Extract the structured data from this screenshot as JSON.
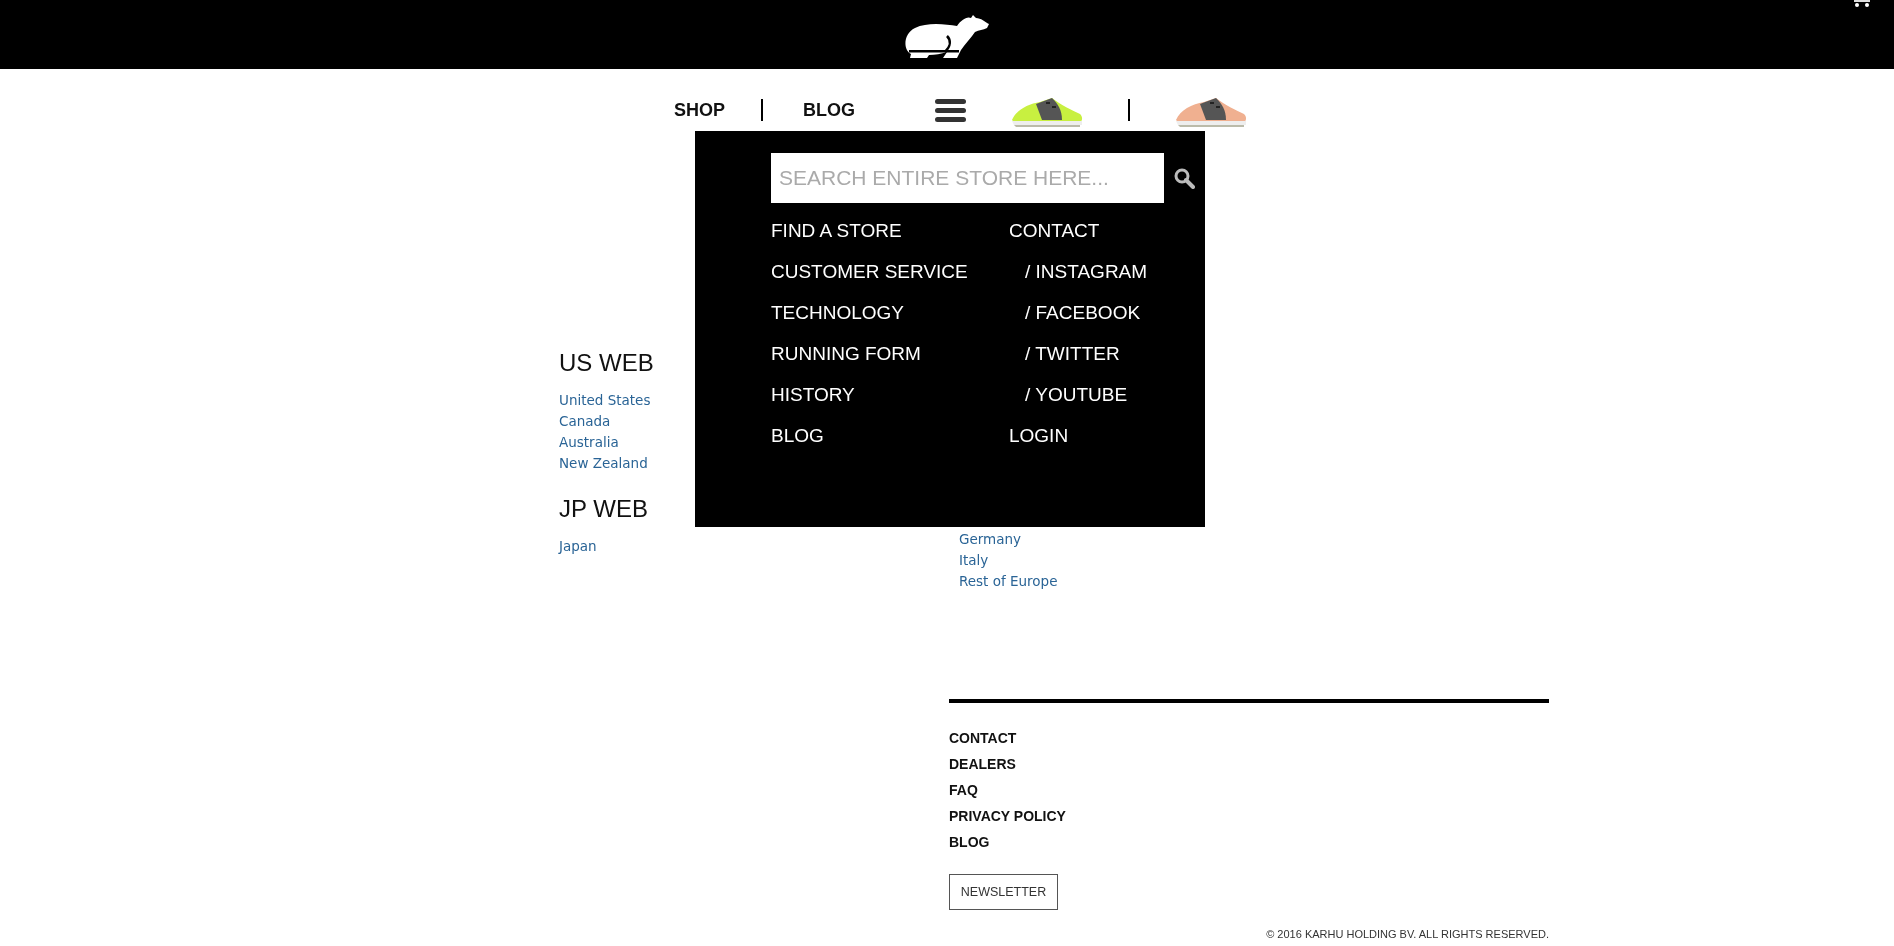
{
  "nav": {
    "items": [
      {
        "label": "SHOP"
      },
      {
        "label": "BLOG"
      }
    ]
  },
  "menu": {
    "search": {
      "placeholder": "SEARCH ENTIRE STORE HERE..."
    },
    "left": [
      {
        "label": "FIND A STORE"
      },
      {
        "label": "CUSTOMER SERVICE"
      },
      {
        "label": "TECHNOLOGY"
      },
      {
        "label": "RUNNING FORM"
      },
      {
        "label": "HISTORY"
      },
      {
        "label": "BLOG"
      }
    ],
    "right": [
      {
        "label": "CONTACT",
        "kind": "main"
      },
      {
        "label": "/ INSTAGRAM",
        "kind": "social"
      },
      {
        "label": "/ FACEBOOK",
        "kind": "social"
      },
      {
        "label": "/ TWITTER",
        "kind": "social"
      },
      {
        "label": "/ YOUTUBE",
        "kind": "social"
      },
      {
        "label": "LOGIN",
        "kind": "main"
      }
    ]
  },
  "regions": [
    {
      "title": "US WEB",
      "links": [
        "United States",
        "Canada",
        "Australia",
        "New Zealand"
      ]
    },
    {
      "title": "JP WEB",
      "links": [
        "Japan"
      ]
    }
  ],
  "eu_links": [
    "Germany",
    "Italy",
    "Rest of Europe"
  ],
  "footer": {
    "links": [
      "CONTACT",
      "DEALERS",
      "FAQ",
      "PRIVACY POLICY",
      "BLOG"
    ],
    "newsletter": "NEWSLETTER",
    "copyright": "© 2016 KARHU HOLDING BV. ALL RIGHTS RESERVED."
  }
}
